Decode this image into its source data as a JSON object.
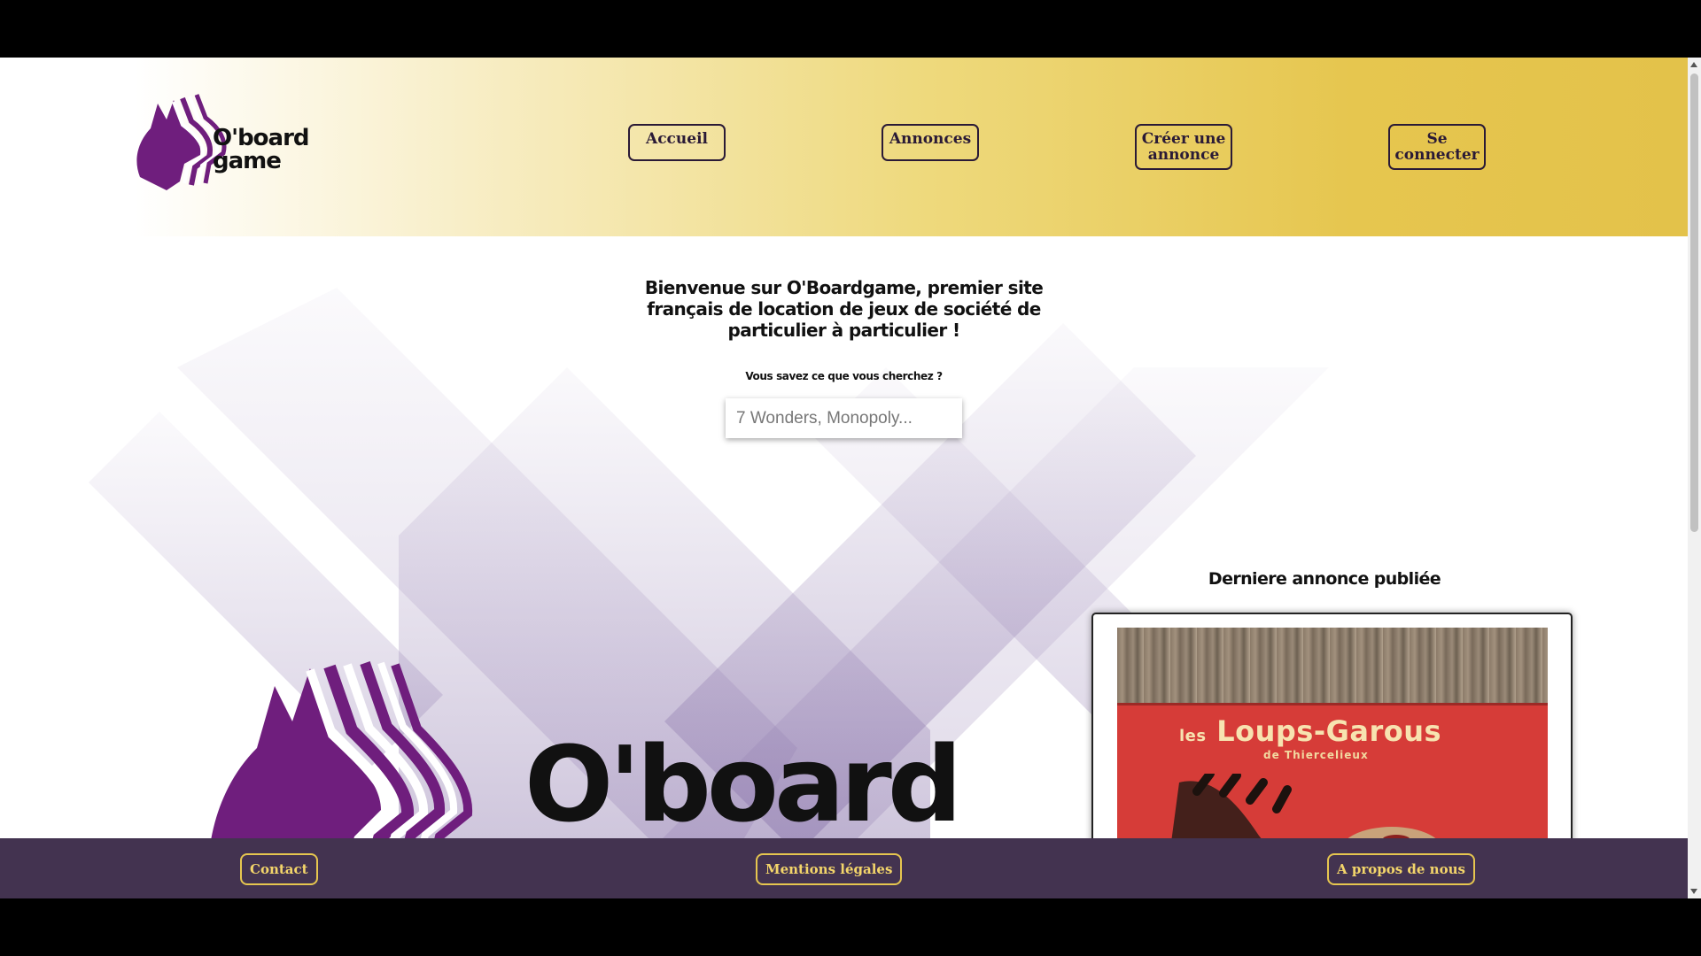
{
  "header": {
    "logo_text_line1": "O'board",
    "logo_text_line2": "game",
    "nav": {
      "home": "Accueil",
      "ads": "Annonces",
      "create_ad_line1": "Créer une",
      "create_ad_line2": "annonce",
      "login_line1": "Se",
      "login_line2": "connecter"
    }
  },
  "main": {
    "intro": "Bienvenue sur O'Boardgame, premier site français de location de jeux de société de particulier à particulier !",
    "search_label": "Vous savez ce que vous cherchez ?",
    "search_placeholder": "7 Wonders, Monopoly...",
    "big_logo_text": "O'board",
    "latest_title": "Derniere annonce publiée",
    "latest_card": {
      "box_prefix": "les",
      "box_title": "Loups-Garous",
      "box_subtitle": "de Thiercelieux"
    }
  },
  "footer": {
    "contact": "Contact",
    "legal": "Mentions légales",
    "about": "A propos de nous"
  },
  "colors": {
    "header_gold": "#e3c24a",
    "brand_purple": "#6f1e7d",
    "footer_bg": "#433350",
    "footer_accent": "#e6c64f"
  }
}
